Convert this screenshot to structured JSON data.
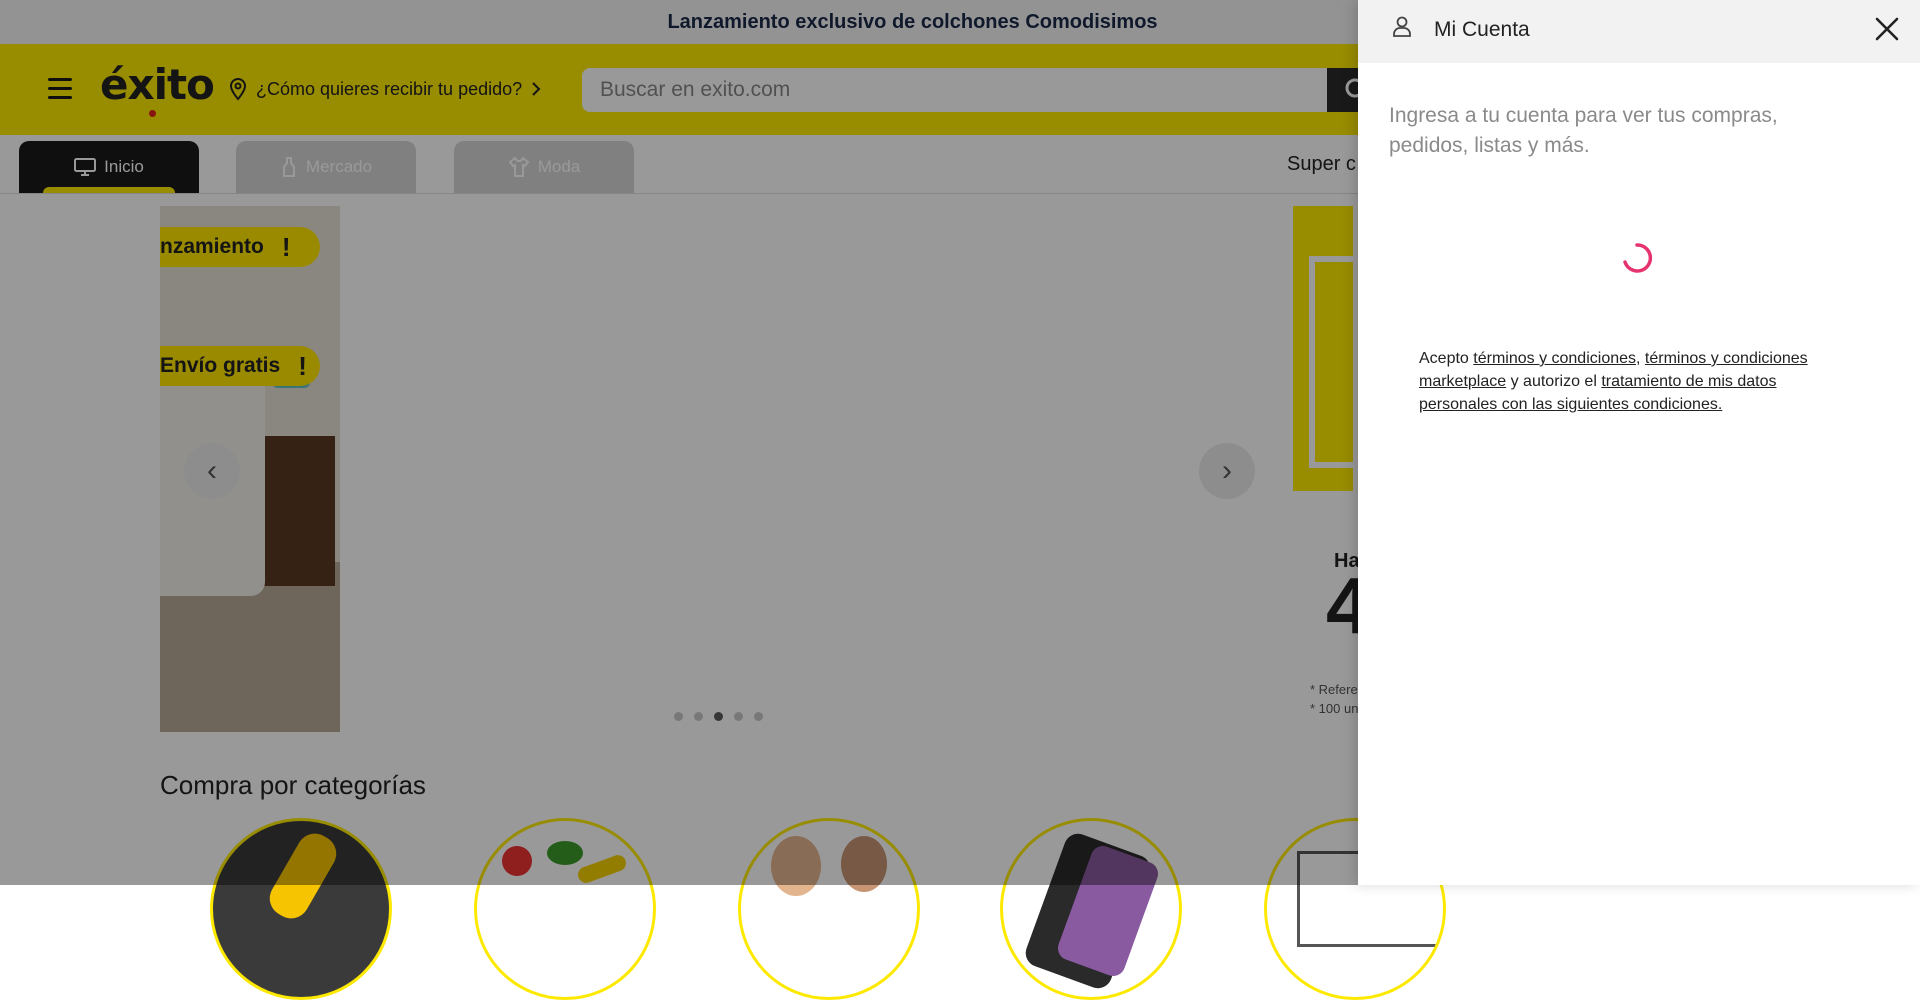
{
  "announcement": {
    "text": "Lanzamiento exclusivo de colchones Comodisimos"
  },
  "header": {
    "logo_text": "éxito",
    "delivery_label": "¿Cómo quieres recibir tu pedido?",
    "search_placeholder": "Buscar en exito.com"
  },
  "tabs": [
    {
      "label": "Inicio",
      "icon": "monitor-icon",
      "active": true
    },
    {
      "label": "Mercado",
      "icon": "bottle-icon",
      "active": false
    },
    {
      "label": "Moda",
      "icon": "shirt-icon",
      "active": false
    }
  ],
  "super_link_partial": "Super c",
  "banner": {
    "pill_1": "nzamiento",
    "pill_1_bang": "!",
    "pill_2": "Envío gratis",
    "pill_2_bang": "!",
    "dots_total": 5,
    "dots_active_index": 2,
    "right_promo_partial": "Ha",
    "right_bignum_partial": "4",
    "right_ref_1": "* Refere",
    "right_ref_2": "* 100 un"
  },
  "categories": {
    "title": "Compra por categorías"
  },
  "drawer": {
    "title": "Mi Cuenta",
    "intro": "Ingresa a tu cuenta para ver tus compras, pedidos, listas y más.",
    "terms_prefix": "Acepto ",
    "terms_link_1": "términos y condiciones",
    "terms_sep": ", ",
    "terms_link_2": "términos y condiciones marketplace",
    "terms_mid": " y autorizo el ",
    "terms_link_3": "tratamiento de mis datos personales con las siguientes condiciones."
  },
  "colors": {
    "brand_yellow": "#fde900",
    "spinner_pink": "#e6336e",
    "tab_dark": "#1a1a1a"
  }
}
